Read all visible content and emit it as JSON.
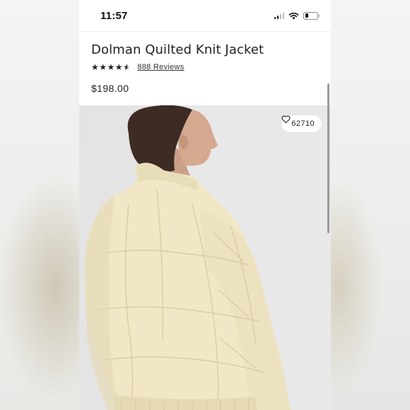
{
  "status_bar": {
    "time": "11:57",
    "icons": [
      "cellular-signal-icon",
      "wifi-icon",
      "battery-icon"
    ]
  },
  "product": {
    "title": "Dolman Quilted Knit Jacket",
    "rating_out_of_5": 4.5,
    "reviews_label": "888 Reviews",
    "price": "$198.00",
    "like_count": "62710"
  },
  "colors": {
    "text": "#222222",
    "jacket": "#f1e7c6",
    "image_bg": "#e3e3e3"
  }
}
